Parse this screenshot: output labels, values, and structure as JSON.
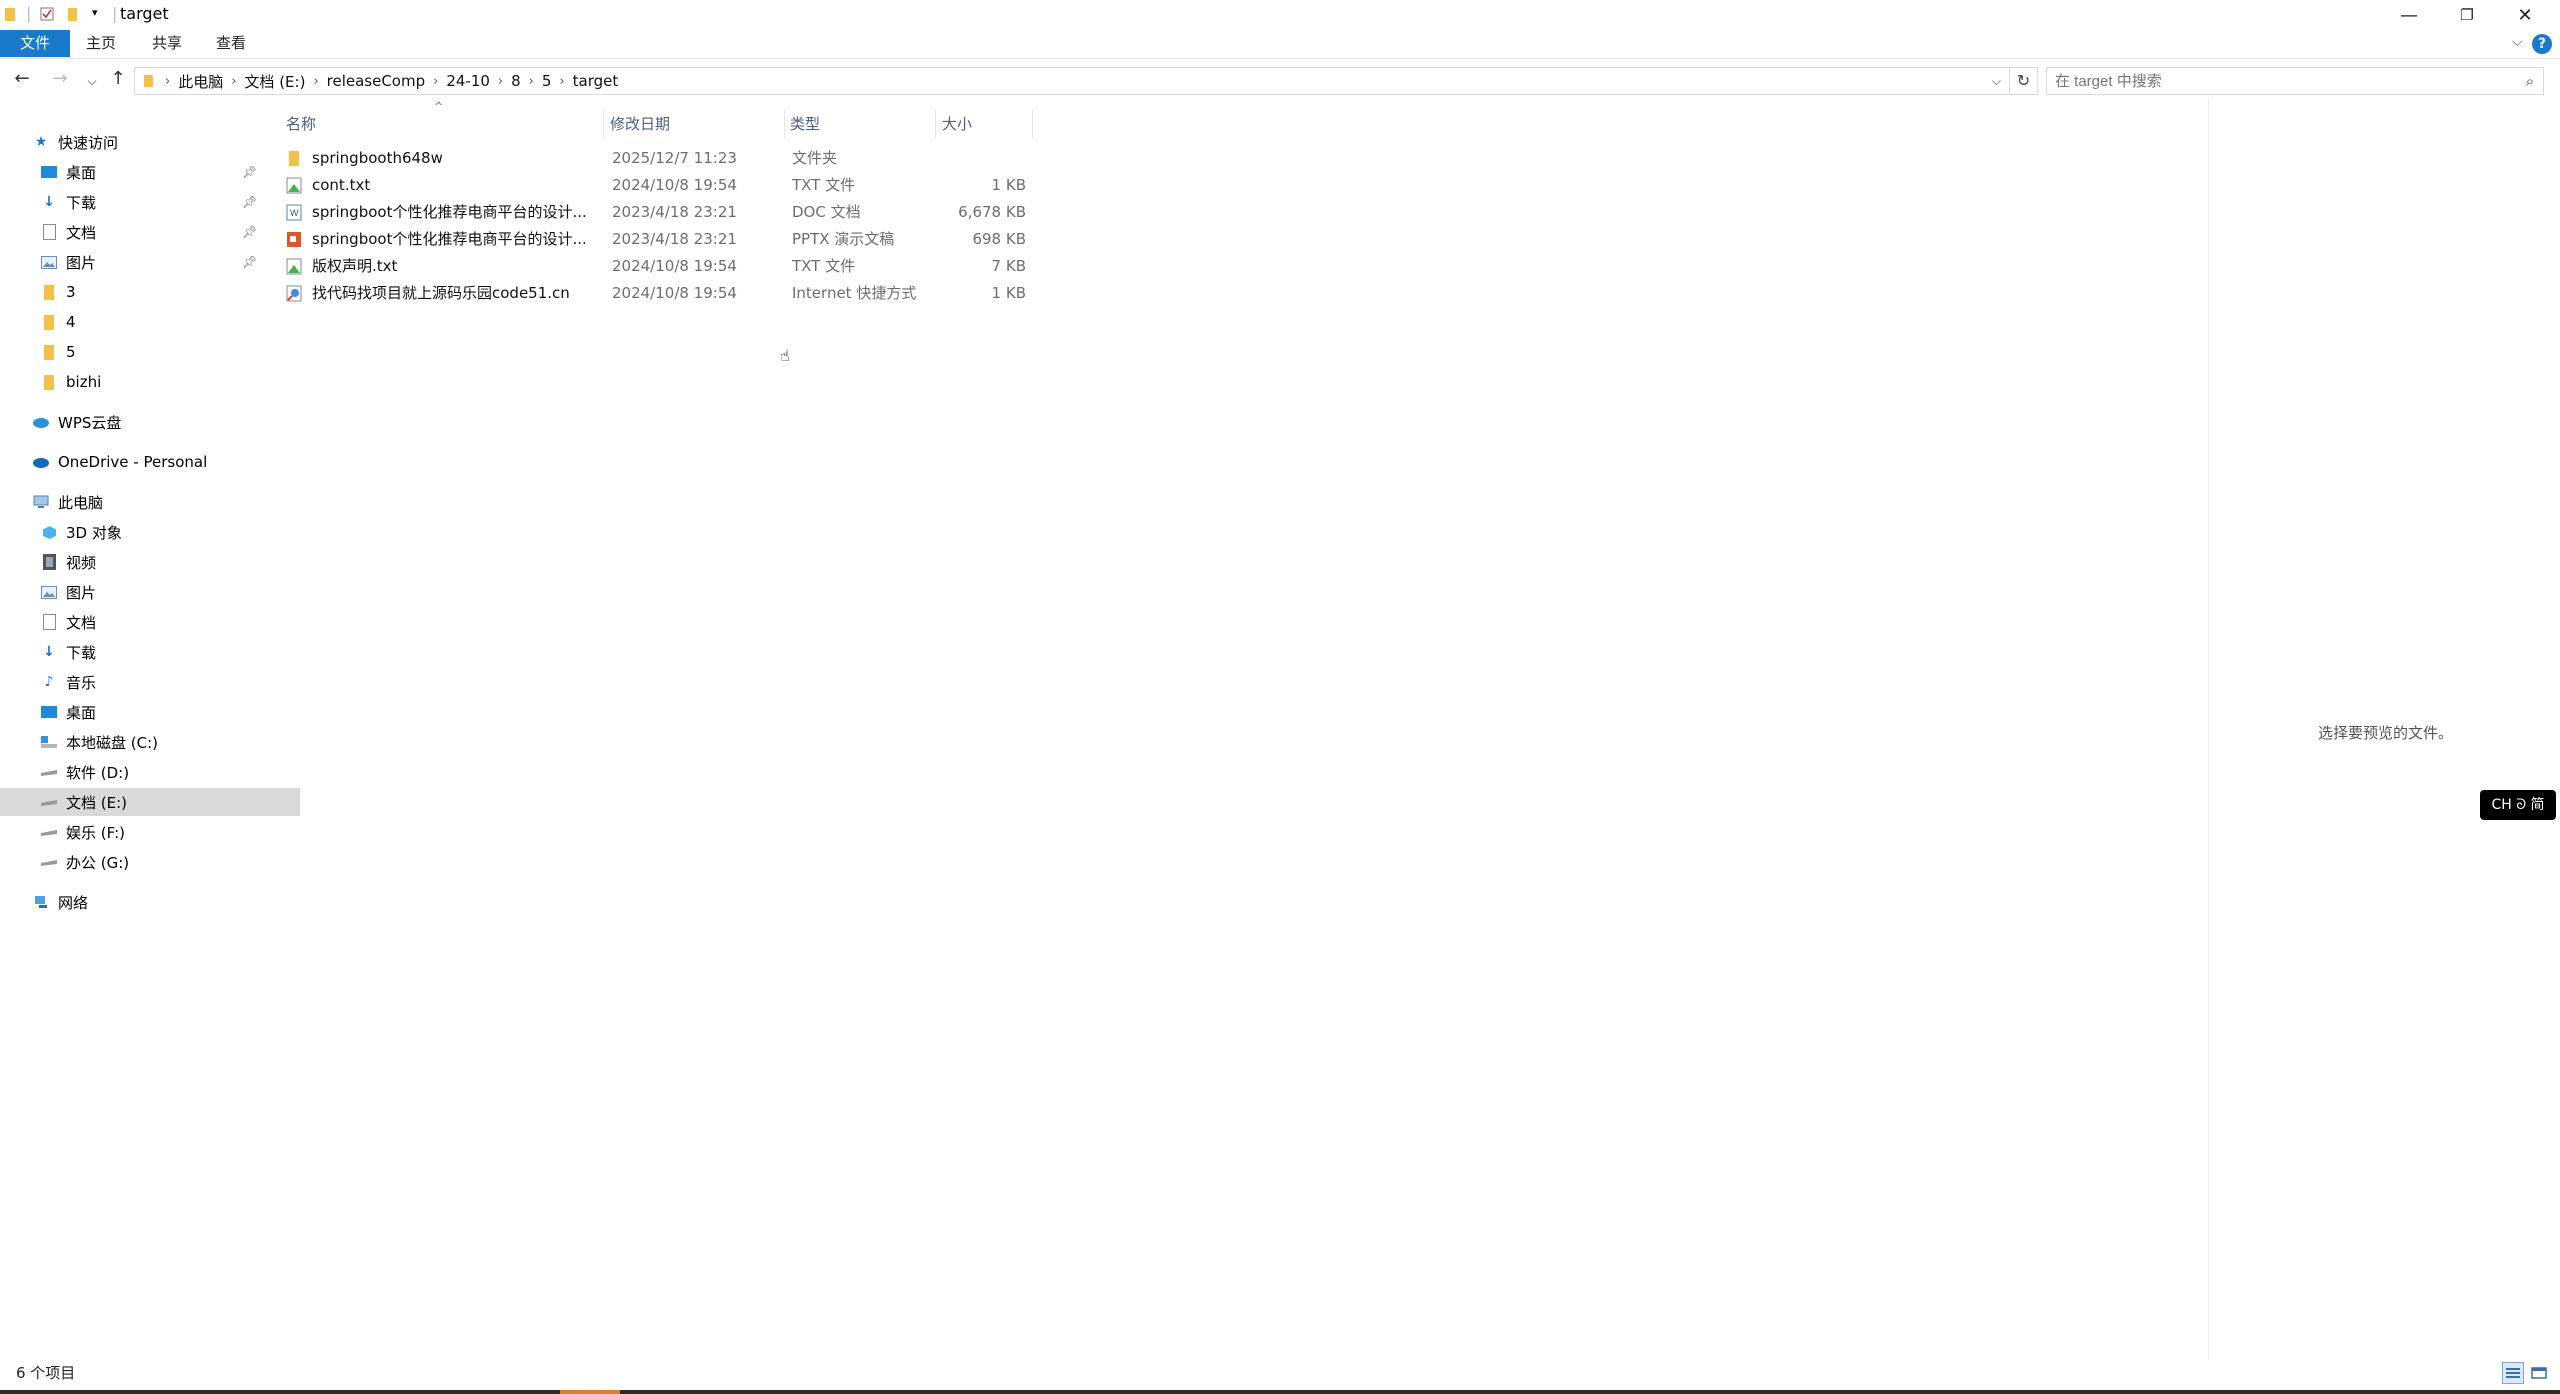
{
  "window": {
    "title": "target",
    "controls": {
      "minimize": "—",
      "maximize": "❐",
      "close": "✕"
    }
  },
  "ribbon": {
    "tabs": [
      {
        "label": "文件"
      },
      {
        "label": "主页"
      },
      {
        "label": "共享"
      },
      {
        "label": "查看"
      }
    ],
    "help": "?"
  },
  "address": {
    "breadcrumbs": [
      "此电脑",
      "文档 (E:)",
      "releaseComp",
      "24-10",
      "8",
      "5",
      "target"
    ]
  },
  "search": {
    "placeholder": "在 target 中搜索"
  },
  "nav": {
    "quick_access": {
      "label": "快速访问"
    },
    "quick_items": [
      {
        "label": "桌面",
        "pinned": true
      },
      {
        "label": "下载",
        "pinned": true
      },
      {
        "label": "文档",
        "pinned": true
      },
      {
        "label": "图片",
        "pinned": true
      },
      {
        "label": "3"
      },
      {
        "label": "4"
      },
      {
        "label": "5"
      },
      {
        "label": "bizhi"
      }
    ],
    "wps": "WPS云盘",
    "onedrive": "OneDrive - Personal",
    "this_pc": "此电脑",
    "pc_items": [
      {
        "label": "3D 对象"
      },
      {
        "label": "视频"
      },
      {
        "label": "图片"
      },
      {
        "label": "文档"
      },
      {
        "label": "下载"
      },
      {
        "label": "音乐"
      },
      {
        "label": "桌面"
      },
      {
        "label": "本地磁盘 (C:)"
      },
      {
        "label": "软件 (D:)"
      },
      {
        "label": "文档 (E:)",
        "selected": true
      },
      {
        "label": "娱乐 (F:)"
      },
      {
        "label": "办公 (G:)"
      }
    ],
    "network": "网络"
  },
  "columns": {
    "name": "名称",
    "date": "修改日期",
    "type": "类型",
    "size": "大小"
  },
  "files": [
    {
      "name": "springbooth648w",
      "date": "2025/12/7 11:23",
      "type": "文件夹",
      "size": "",
      "icon": "folder-icon"
    },
    {
      "name": "cont.txt",
      "date": "2024/10/8 19:54",
      "type": "TXT 文件",
      "size": "1 KB",
      "icon": "txt-icon"
    },
    {
      "name": "springboot个性化推荐电商平台的设计...",
      "date": "2023/4/18 23:21",
      "type": "DOC 文档",
      "size": "6,678 KB",
      "icon": "doc-icon"
    },
    {
      "name": "springboot个性化推荐电商平台的设计...",
      "date": "2023/4/18 23:21",
      "type": "PPTX 演示文稿",
      "size": "698 KB",
      "icon": "pptx-icon"
    },
    {
      "name": "版权声明.txt",
      "date": "2024/10/8 19:54",
      "type": "TXT 文件",
      "size": "7 KB",
      "icon": "txt-icon"
    },
    {
      "name": "找代码找项目就上源码乐园code51.cn",
      "date": "2024/10/8 19:54",
      "type": "Internet 快捷方式",
      "size": "1 KB",
      "icon": "url-shortcut-icon"
    }
  ],
  "preview": {
    "message": "选择要预览的文件。"
  },
  "ime": {
    "label": "CH ᘐ 简"
  },
  "status": {
    "item_count": "6 个项目"
  },
  "colors": {
    "accent": "#1979ca",
    "selection": "#d9d9d9",
    "header_text": "#4c607a"
  }
}
